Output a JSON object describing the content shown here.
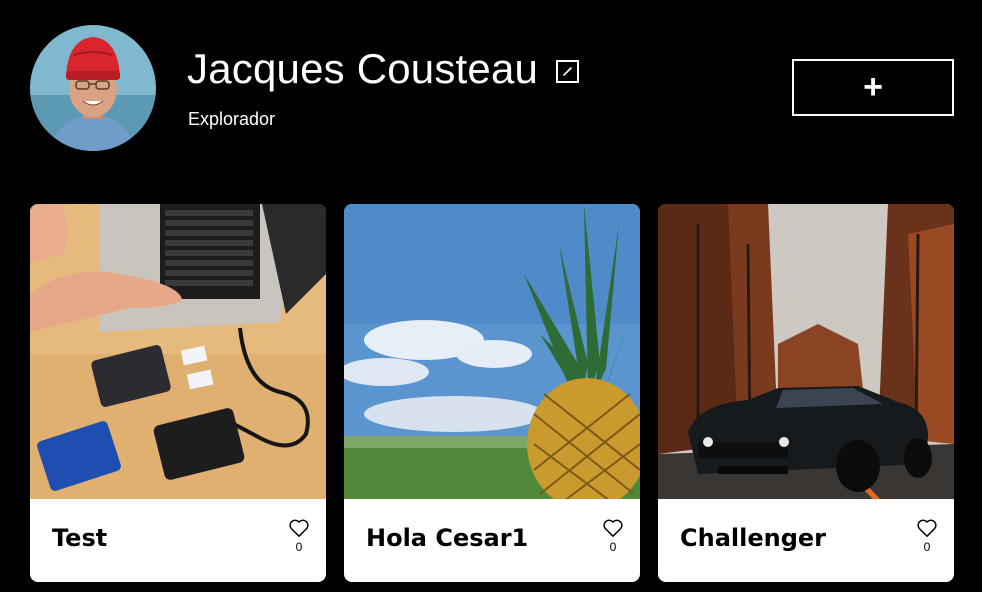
{
  "profile": {
    "name": "Jacques Cousteau",
    "role": "Explorador",
    "avatar_icon": "person-avatar"
  },
  "actions": {
    "add_label": "+",
    "edit_icon": "pencil-icon"
  },
  "cards": [
    {
      "title": "Test",
      "likes": "0",
      "image": "laptop-and-ssd-photo"
    },
    {
      "title": "Hola Cesar1",
      "likes": "0",
      "image": "pineapple-photo"
    },
    {
      "title": "Challenger",
      "likes": "0",
      "image": "black-car-forest-photo"
    }
  ],
  "colors": {
    "background": "#000000",
    "card": "#ffffff",
    "text": "#ffffff",
    "card_text": "#000000"
  }
}
